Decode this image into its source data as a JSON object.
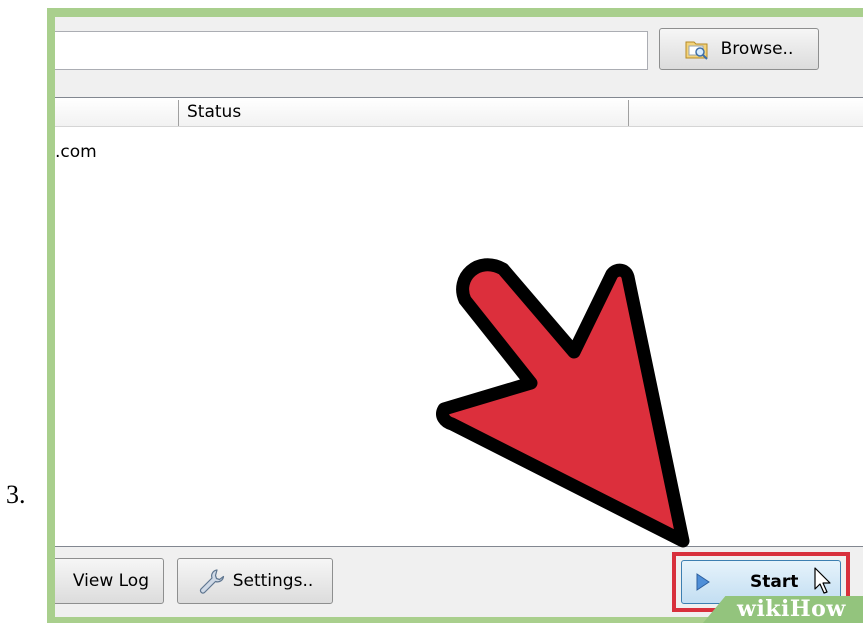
{
  "step": {
    "number": "3."
  },
  "path_field": {
    "value": ""
  },
  "browse_button": {
    "label": "Browse..",
    "icon": "folder-search-icon"
  },
  "list": {
    "columns": [
      "",
      "Status",
      ""
    ],
    "rows": [
      {
        "name": ".com",
        "status": ""
      }
    ]
  },
  "bottom_bar": {
    "view_log_label": "View Log",
    "settings_label": "Settings..",
    "settings_icon": "wrench-icon",
    "start_label": "Start",
    "start_icon": "play-icon"
  },
  "annotation": {
    "arrow_color": "#dc2f3c",
    "highlight_color": "#d8303c"
  },
  "watermark": {
    "text": "wikiHow"
  }
}
